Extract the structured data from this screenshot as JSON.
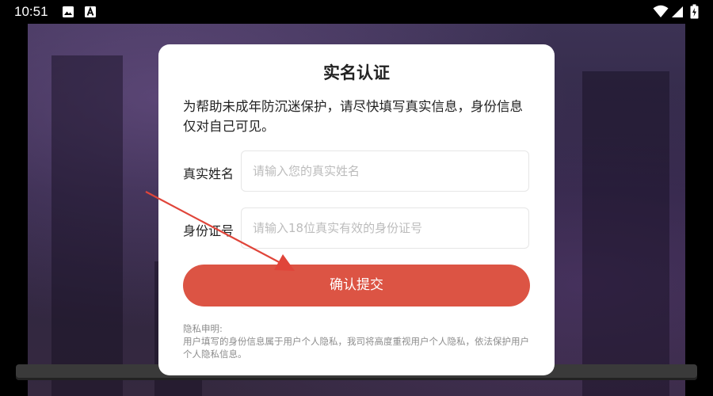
{
  "status_bar": {
    "time": "10:51",
    "icons": [
      "image-icon",
      "text-a-icon"
    ],
    "right_icons": [
      "wifi-icon",
      "signal-icon",
      "battery-icon"
    ]
  },
  "dialog": {
    "title": "实名认证",
    "description": "为帮助未成年防沉迷保护，请尽快填写真实信息，身份信息仅对自己可见。",
    "name_field": {
      "label": "真实姓名",
      "value": "",
      "placeholder": "请输入您的真实姓名"
    },
    "id_field": {
      "label": "身份证号",
      "value": "",
      "placeholder": "请输入18位真实有效的身份证号"
    },
    "submit_label": "确认提交",
    "privacy_title": "隐私申明:",
    "privacy_text": "用户填写的身份信息属于用户个人隐私，我司将高度重视用户个人隐私，依法保护用户个人隐私信息。"
  },
  "colors": {
    "accent": "#dc5444",
    "annotation_arrow": "#e0453a"
  }
}
